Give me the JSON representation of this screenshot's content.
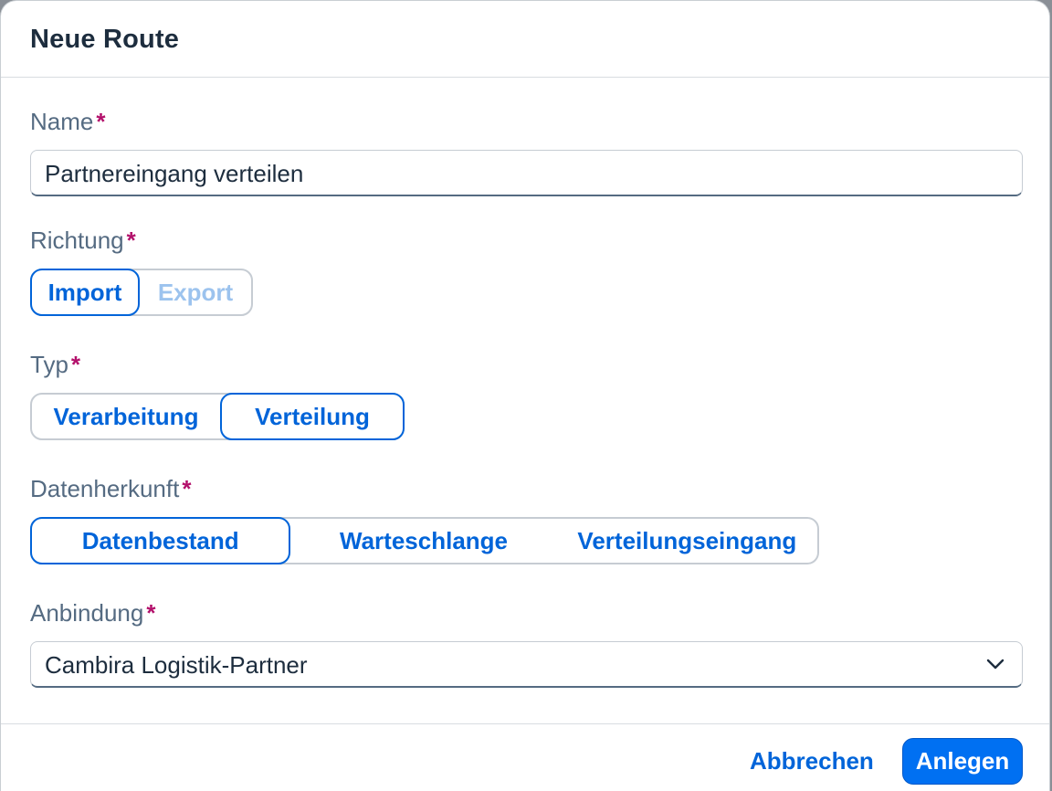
{
  "dialog": {
    "title": "Neue Route"
  },
  "fields": {
    "name": {
      "label": "Name",
      "required_mark": "*",
      "value": "Partnereingang verteilen"
    },
    "direction": {
      "label": "Richtung",
      "required_mark": "*",
      "options": [
        "Import",
        "Export"
      ],
      "selected": "Import",
      "disabled": [
        "Export"
      ]
    },
    "type": {
      "label": "Typ",
      "required_mark": "*",
      "options": [
        "Verarbeitung",
        "Verteilung"
      ],
      "selected": "Verteilung"
    },
    "data_origin": {
      "label": "Datenherkunft",
      "required_mark": "*",
      "options": [
        "Datenbestand",
        "Warteschlange",
        "Verteilungseingang"
      ],
      "selected": "Datenbestand"
    },
    "binding": {
      "label": "Anbindung",
      "required_mark": "*",
      "value": "Cambira Logistik-Partner",
      "icon": "chevron-down-icon"
    }
  },
  "footer": {
    "cancel_label": "Abbrechen",
    "create_label": "Anlegen"
  },
  "colors": {
    "accent": "#0064d9",
    "primary_button": "#0070f2",
    "required": "#b3106b",
    "label": "#556b82",
    "text": "#1d2d3e"
  }
}
